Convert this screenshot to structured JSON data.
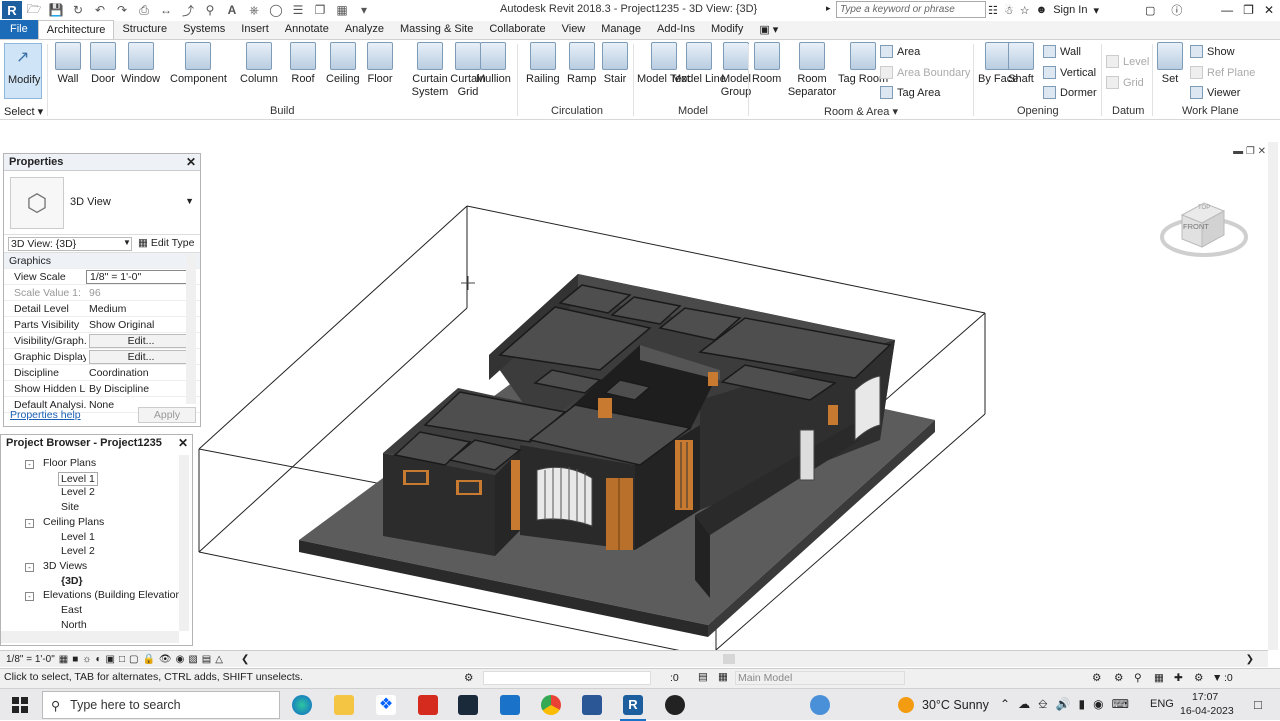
{
  "app": {
    "title": "Autodesk Revit 2018.3 -    Project1235 - 3D View: {3D}",
    "search_placeholder": "Type a keyword or phrase",
    "sign_in": "Sign In",
    "logo": "R"
  },
  "tabs": [
    "File",
    "Architecture",
    "Structure",
    "Systems",
    "Insert",
    "Annotate",
    "Analyze",
    "Massing & Site",
    "Collaborate",
    "View",
    "Manage",
    "Add-Ins",
    "Modify"
  ],
  "active_tab": "Architecture",
  "ribbon": {
    "modify": "Modify",
    "select": "Select",
    "build": {
      "label": "Build",
      "items": [
        "Wall",
        "Door",
        "Window",
        "Component",
        "Column",
        "Roof",
        "Ceiling",
        "Floor",
        "Curtain System",
        "Curtain Grid",
        "Mullion"
      ]
    },
    "circulation": {
      "label": "Circulation",
      "items": [
        "Railing",
        "Ramp",
        "Stair"
      ]
    },
    "model": {
      "label": "Model",
      "items": [
        "Model Text",
        "Model Line",
        "Model Group"
      ]
    },
    "room_area": {
      "label": "Room & Area",
      "items": [
        "Room",
        "Room Separator",
        "Tag Room"
      ],
      "small": [
        "Area",
        "Area  Boundary",
        "Tag  Area"
      ]
    },
    "opening": {
      "label": "Opening",
      "items": [
        "By Face",
        "Shaft"
      ],
      "small": [
        "Wall",
        "Vertical",
        "Dormer"
      ]
    },
    "datum": {
      "label": "Datum",
      "small": [
        "Level",
        "Grid"
      ]
    },
    "work_plane": {
      "label": "Work Plane",
      "items": [
        "Set"
      ],
      "small": [
        "Show",
        "Ref  Plane",
        "Viewer"
      ]
    }
  },
  "properties": {
    "title": "Properties",
    "type_name": "3D View",
    "view_select": "3D View: {3D}",
    "edit_type": "Edit Type",
    "section": "Graphics",
    "rows": [
      {
        "k": "View Scale",
        "v": "1/8\" = 1'-0\""
      },
      {
        "k": "Scale Value    1:",
        "v": "96"
      },
      {
        "k": "Detail Level",
        "v": "Medium"
      },
      {
        "k": "Parts Visibility",
        "v": "Show Original"
      },
      {
        "k": "Visibility/Graph...",
        "v": "Edit..."
      },
      {
        "k": "Graphic Display...",
        "v": "Edit..."
      },
      {
        "k": "Discipline",
        "v": "Coordination"
      },
      {
        "k": "Show Hidden Li...",
        "v": "By Discipline"
      },
      {
        "k": "Default Analysi...",
        "v": "None"
      }
    ],
    "help": "Properties help",
    "apply": "Apply"
  },
  "browser": {
    "title": "Project Browser - Project1235",
    "tree": [
      {
        "label": "Floor Plans",
        "level": 1,
        "box": "-"
      },
      {
        "label": "Level 1",
        "level": 2,
        "selected": true
      },
      {
        "label": "Level 2",
        "level": 2
      },
      {
        "label": "Site",
        "level": 2
      },
      {
        "label": "Ceiling Plans",
        "level": 1,
        "box": "-"
      },
      {
        "label": "Level 1",
        "level": 2
      },
      {
        "label": "Level 2",
        "level": 2
      },
      {
        "label": "3D Views",
        "level": 1,
        "box": "-"
      },
      {
        "label": "{3D}",
        "level": 2,
        "bold": true
      },
      {
        "label": "Elevations (Building Elevation",
        "level": 1,
        "box": "-"
      },
      {
        "label": "East",
        "level": 2
      },
      {
        "label": "North",
        "level": 2
      }
    ]
  },
  "viewcube": {
    "face": "FRONT",
    "top": "TOP"
  },
  "view_control": {
    "scale": "1/8\" = 1'-0\""
  },
  "status": {
    "hint": "Click to select, TAB for alternates, CTRL adds, SHIFT unselects.",
    "selection_count": ":0",
    "model": "Main Model",
    "filter_count": ":0"
  },
  "taskbar": {
    "search": "Type here to search",
    "weather": "30°C  Sunny",
    "lang": "ENG",
    "time": "17:07",
    "date": "16-04-2023"
  }
}
